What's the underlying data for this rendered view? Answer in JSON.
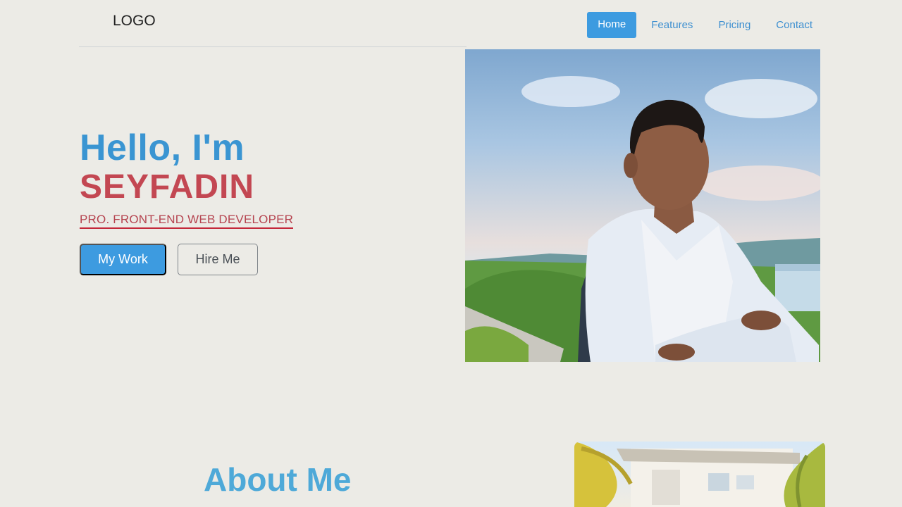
{
  "header": {
    "logo": "LOGO",
    "nav": [
      {
        "label": "Home",
        "active": true
      },
      {
        "label": "Features",
        "active": false
      },
      {
        "label": "Pricing",
        "active": false
      },
      {
        "label": "Contact",
        "active": false
      }
    ]
  },
  "hero": {
    "greeting": "Hello, I'm",
    "name": "SEYFADIN",
    "tagline": "PRO. FRONT-END WEB DEVELOPER",
    "primary_button": "My Work",
    "secondary_button": "Hire Me"
  },
  "about": {
    "title": "About Me"
  },
  "colors": {
    "accent_blue": "#3d9be0",
    "heading_blue": "#3a95d2",
    "name_red": "#c34752",
    "background": "#ecebe6"
  }
}
